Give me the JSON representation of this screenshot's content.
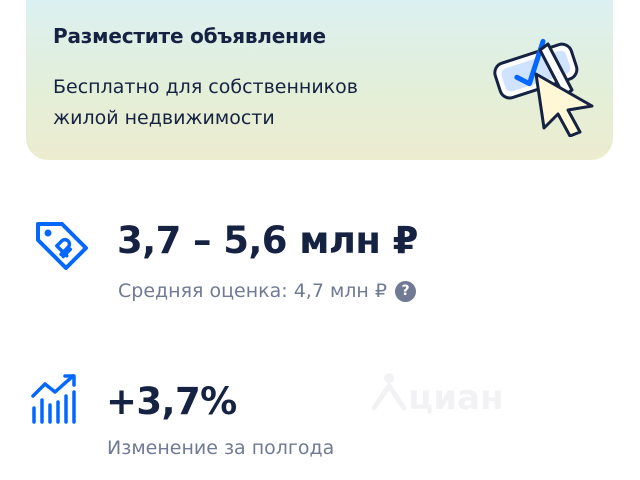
{
  "promo": {
    "title": "Разместите объявление",
    "description_line1": "Бесплатно для собственников",
    "description_line2": "жилой недвижимости",
    "illustration_icon": "checkbox-cursor-icon"
  },
  "price": {
    "icon": "price-tag-icon",
    "range": "3,7 – 5,6 млн ₽",
    "average_label": "Средняя оценка: 4,7 млн ₽",
    "help_glyph": "?"
  },
  "growth": {
    "icon": "growth-chart-icon",
    "value": "+3,7%",
    "label": "Изменение за полгода"
  },
  "watermark": {
    "text": "циан"
  },
  "colors": {
    "primary_text": "#152242",
    "secondary_text": "#707a95",
    "accent_blue": "#0468ff",
    "card_top": "#d9f0f6",
    "card_bottom": "#ececcf"
  }
}
